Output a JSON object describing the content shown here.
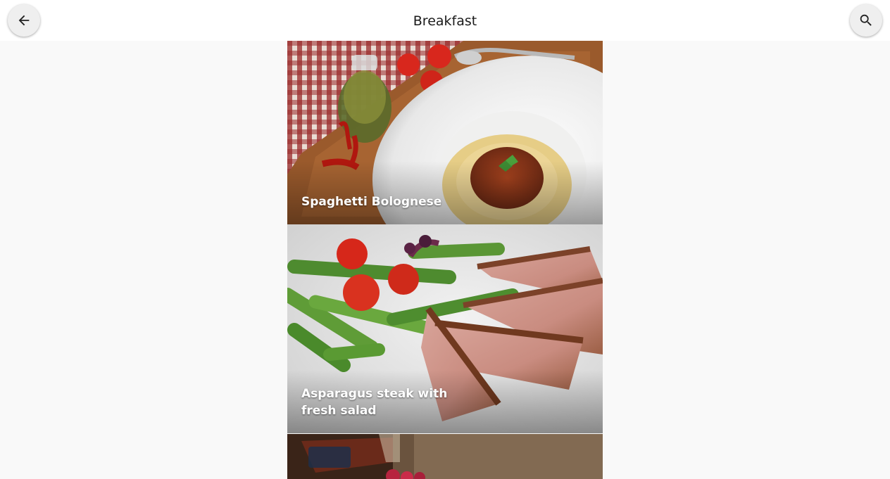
{
  "header": {
    "title": "Breakfast",
    "back_icon": "arrow-back-icon",
    "search_icon": "search-icon"
  },
  "recipes": [
    {
      "name": "Spaghetti Bolognese",
      "image": "spaghetti-bolognese-photo"
    },
    {
      "name": "Asparagus steak with fresh salad",
      "image": "asparagus-steak-photo"
    },
    {
      "name": "",
      "image": "syrup-berries-photo"
    }
  ]
}
